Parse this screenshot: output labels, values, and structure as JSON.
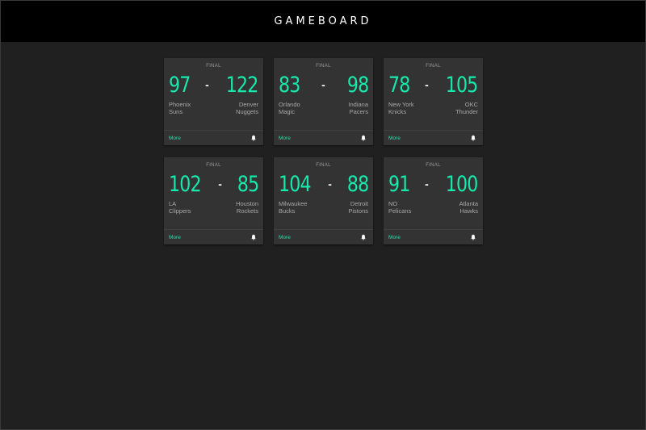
{
  "app": {
    "title": "GAMEBOARD"
  },
  "colors": {
    "accent": "#17e8ab",
    "background": "#202020",
    "card": "#333333",
    "header": "#000000"
  },
  "games": [
    {
      "status": "FINAL",
      "home_score": "97",
      "away_score": "122",
      "home_team": [
        "Phoenix",
        "Suns"
      ],
      "away_team": [
        "Denver",
        "Nuggets"
      ],
      "more_label": "More",
      "icon": "bell-icon"
    },
    {
      "status": "FINAL",
      "home_score": "83",
      "away_score": "98",
      "home_team": [
        "Orlando",
        "Magic"
      ],
      "away_team": [
        "Indiana",
        "Pacers"
      ],
      "more_label": "More",
      "icon": "bell-icon"
    },
    {
      "status": "FINAL",
      "home_score": "78",
      "away_score": "105",
      "home_team": [
        "New York",
        "Knicks"
      ],
      "away_team": [
        "OKC",
        "Thunder"
      ],
      "more_label": "More",
      "icon": "bell-icon"
    },
    {
      "status": "FINAL",
      "home_score": "102",
      "away_score": "85",
      "home_team": [
        "LA",
        "Clippers"
      ],
      "away_team": [
        "Houston",
        "Rockets"
      ],
      "more_label": "More",
      "icon": "bell-icon"
    },
    {
      "status": "FINAL",
      "home_score": "104",
      "away_score": "88",
      "home_team": [
        "Milwaukee",
        "Bucks"
      ],
      "away_team": [
        "Detroit",
        "Pistons"
      ],
      "more_label": "More",
      "icon": "bell-icon"
    },
    {
      "status": "FINAL",
      "home_score": "91",
      "away_score": "100",
      "home_team": [
        "NO",
        "Pelicans"
      ],
      "away_team": [
        "Atlanta",
        "Hawks"
      ],
      "more_label": "More",
      "icon": "bell-icon"
    }
  ],
  "separator": "-"
}
